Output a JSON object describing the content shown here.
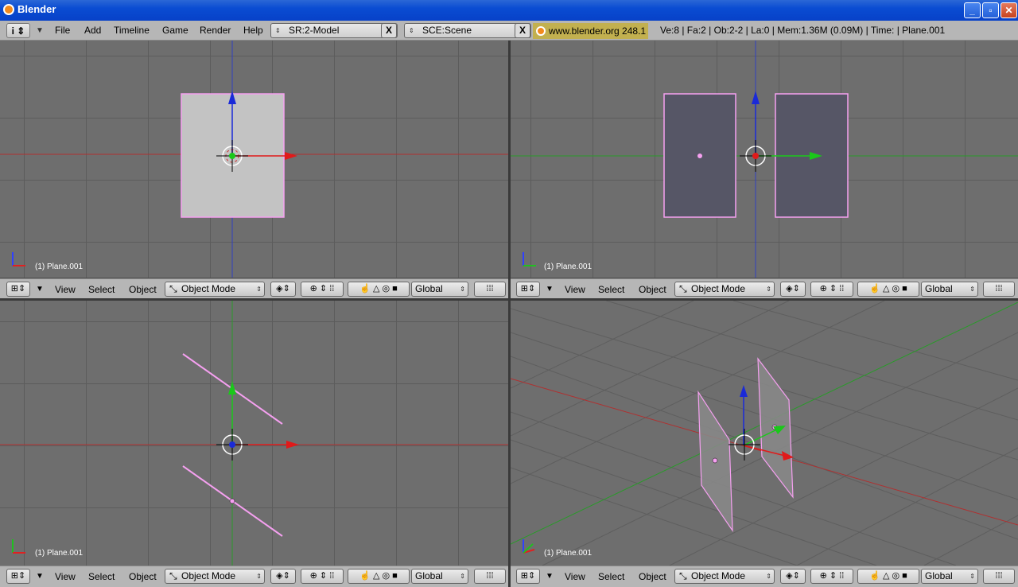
{
  "window": {
    "title": "Blender",
    "minimize": "_",
    "maximize": "▫",
    "close": "✕"
  },
  "info": {
    "menu": [
      "File",
      "Add",
      "Timeline",
      "Game",
      "Render",
      "Help"
    ],
    "screen_field": "SR:2-Model",
    "scene_field": "SCE:Scene",
    "clear_label": "X",
    "weblink": "www.blender.org 248.1",
    "stats": "Ve:8 | Fa:2 | Ob:2-2 | La:0  | Mem:1.36M (0.09M)  | Time: | Plane.001"
  },
  "viewports": [
    {
      "name": "top-left",
      "label": "(1) Plane.001"
    },
    {
      "name": "top-right",
      "label": "(1) Plane.001"
    },
    {
      "name": "bottom-left",
      "label": "(1) Plane.001"
    },
    {
      "name": "bottom-right",
      "label": "(1) Plane.001"
    }
  ],
  "view_header": {
    "view": "View",
    "select": "Select",
    "object": "Object",
    "mode": "Object Mode",
    "orientation": "Global"
  },
  "colors": {
    "x_axis": "#e01a1a",
    "y_axis": "#1ac81a",
    "z_axis": "#1a2ad8",
    "selected_outline": "#f5a0f0"
  }
}
